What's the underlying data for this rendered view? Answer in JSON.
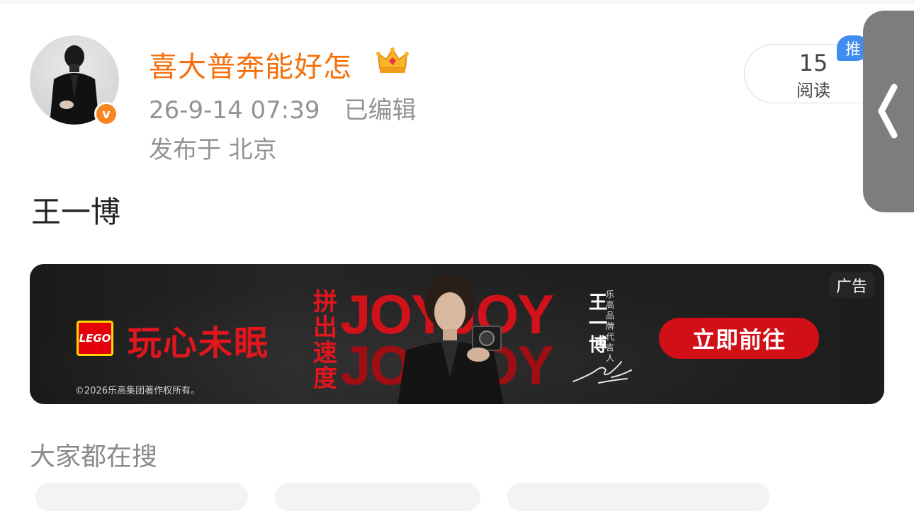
{
  "post": {
    "username": "喜大普奔能好怎",
    "crown_icon": "crown-icon",
    "verified_badge": "v",
    "timestamp": "26-9-14 07:39",
    "edited_label": "已编辑",
    "location": "发布于 北京",
    "read_count": "15",
    "read_label": "阅读",
    "recommend_badge": "推",
    "text": "王一博"
  },
  "ad": {
    "brand_logo": "LEGO",
    "slogan": "玩心未眠",
    "copyright": "©2026乐高集团著作权所有。",
    "vertical_text_chars": [
      "拼",
      "出",
      "速",
      "度"
    ],
    "headline_line1": "JOYJOY",
    "headline_line2": "JOYJOY",
    "spokesperson_chars": [
      "王",
      "一",
      "博"
    ],
    "spokesperson_title_chars": [
      "乐",
      "高",
      "品",
      "牌",
      "代",
      "言",
      "人"
    ],
    "cta_label": "立即前往",
    "ad_tag": "广告"
  },
  "section": {
    "title": "大家都在搜"
  },
  "colors": {
    "username": "#f66f0a",
    "meta": "#939393",
    "ad_red": "#d10f17",
    "badge_blue": "#3f8df0",
    "verified_orange": "#f7861f"
  }
}
